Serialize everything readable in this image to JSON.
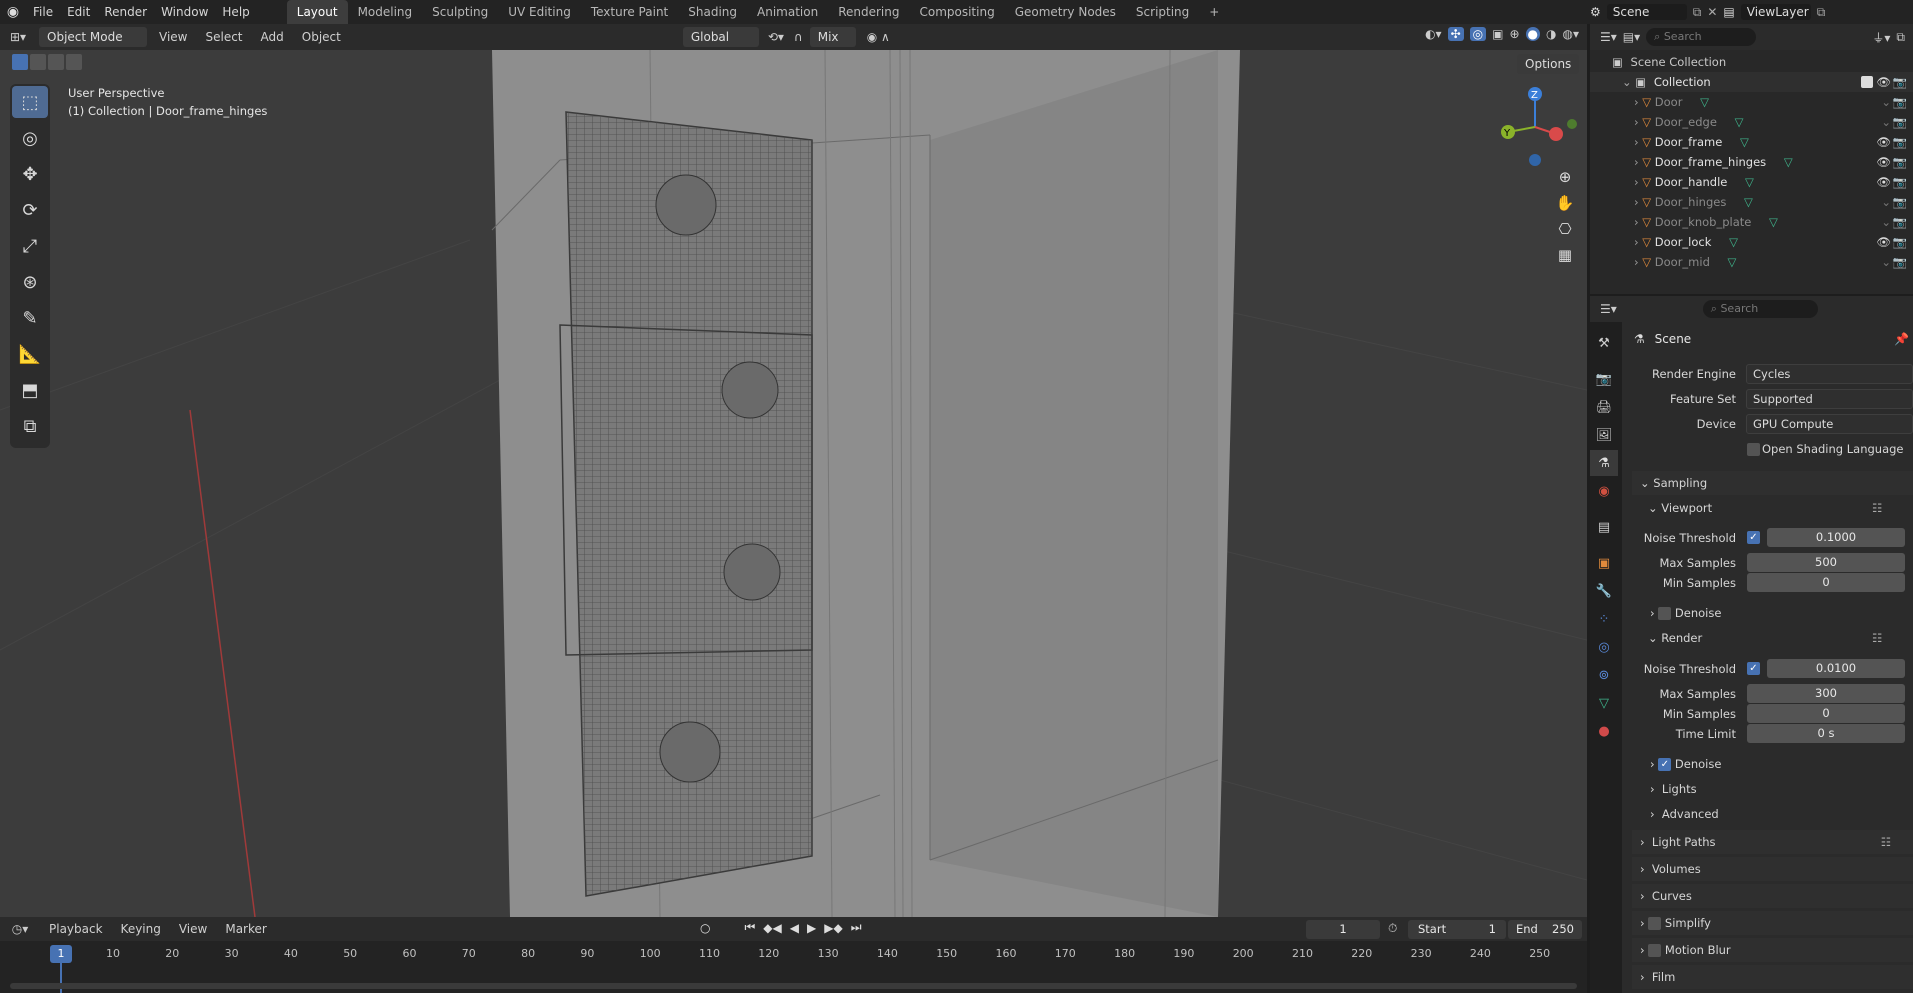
{
  "topbar": {
    "menus": [
      "File",
      "Edit",
      "Render",
      "Window",
      "Help"
    ],
    "workspaces": [
      "Layout",
      "Modeling",
      "Sculpting",
      "UV Editing",
      "Texture Paint",
      "Shading",
      "Animation",
      "Rendering",
      "Compositing",
      "Geometry Nodes",
      "Scripting"
    ],
    "active_workspace": "Layout",
    "add_tab": "+",
    "scene": "Scene",
    "view_layer": "ViewLayer"
  },
  "viewport_header": {
    "mode": "Object Mode",
    "menus": [
      "View",
      "Select",
      "Add",
      "Object"
    ],
    "orientation": "Global",
    "snap_mode": "Mix",
    "options": "Options"
  },
  "viewport": {
    "perspective": "User Perspective",
    "collection_info": "(1) Collection | Door_frame_hinges",
    "gizmo": {
      "z": "Z",
      "y": "Y"
    }
  },
  "tools": [
    "select-box-icon",
    "cursor-icon",
    "move-icon",
    "rotate-icon",
    "scale-icon",
    "transform-icon",
    "annotate-icon",
    "measure-icon",
    "add-cube-icon",
    "extrude-icon"
  ],
  "outliner": {
    "search_placeholder": "Search",
    "scene_collection": "Scene Collection",
    "collection": "Collection",
    "items": [
      {
        "name": "Door",
        "visible": false
      },
      {
        "name": "Door_edge",
        "visible": false
      },
      {
        "name": "Door_frame",
        "visible": true
      },
      {
        "name": "Door_frame_hinges",
        "visible": true
      },
      {
        "name": "Door_handle",
        "visible": true
      },
      {
        "name": "Door_hinges",
        "visible": false
      },
      {
        "name": "Door_knob_plate",
        "visible": false
      },
      {
        "name": "Door_lock",
        "visible": true
      },
      {
        "name": "Door_mid",
        "visible": false
      }
    ]
  },
  "properties": {
    "search_placeholder": "Search",
    "scene_label": "Scene",
    "render_engine_label": "Render Engine",
    "render_engine": "Cycles",
    "feature_set_label": "Feature Set",
    "feature_set": "Supported",
    "device_label": "Device",
    "device": "GPU Compute",
    "osl_label": "Open Shading Language",
    "sampling": "Sampling",
    "viewport": "Viewport",
    "vp_noise_label": "Noise Threshold",
    "vp_noise": "0.1000",
    "vp_max_label": "Max Samples",
    "vp_max": "500",
    "vp_min_label": "Min Samples",
    "vp_min": "0",
    "vp_denoise": "Denoise",
    "render": "Render",
    "r_noise_label": "Noise Threshold",
    "r_noise": "0.0100",
    "r_max_label": "Max Samples",
    "r_max": "300",
    "r_min_label": "Min Samples",
    "r_min": "0",
    "r_time_label": "Time Limit",
    "r_time": "0 s",
    "r_denoise": "Denoise",
    "lights": "Lights",
    "advanced": "Advanced",
    "light_paths": "Light Paths",
    "volumes": "Volumes",
    "curves": "Curves",
    "simplify": "Simplify",
    "motion_blur": "Motion Blur",
    "film": "Film"
  },
  "timeline": {
    "menus": [
      "Playback",
      "Keying",
      "View",
      "Marker"
    ],
    "current_frame": "1",
    "start_label": "Start",
    "start": "1",
    "end_label": "End",
    "end": "250",
    "ticks": [
      "10",
      "20",
      "30",
      "40",
      "50",
      "60",
      "70",
      "80",
      "90",
      "100",
      "110",
      "120",
      "130",
      "140",
      "150",
      "160",
      "170",
      "180",
      "190",
      "200",
      "210",
      "220",
      "230",
      "240",
      "250"
    ],
    "playhead": "1"
  },
  "colors": {
    "accent": "#4772b3",
    "object_icon": "#e08a3c",
    "mesh_icon": "#3fb58c",
    "axis_x": "#d94a4a",
    "axis_y": "#8bb32a",
    "axis_z": "#3b7fd9"
  }
}
